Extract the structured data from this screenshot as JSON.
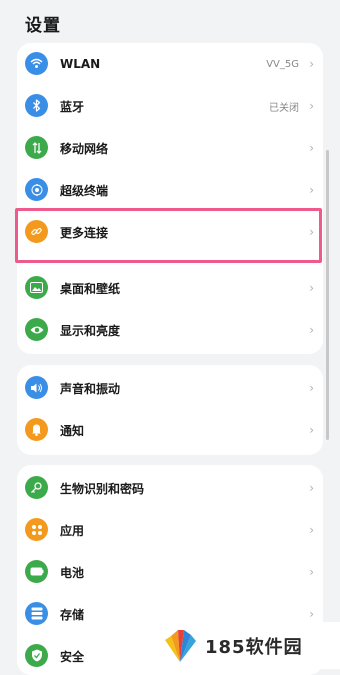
{
  "page_title": "设置",
  "colors": {
    "highlight": "#ee5a8c"
  },
  "group1": [
    {
      "label": "WLAN",
      "value": "VV_5G",
      "icon": "wifi-icon",
      "color": "#3a8ee6"
    },
    {
      "label": "蓝牙",
      "value": "已关闭",
      "icon": "bluetooth-icon",
      "color": "#3a8ee6"
    },
    {
      "label": "移动网络",
      "value": "",
      "icon": "mobile-network-icon",
      "color": "#3caa4a"
    },
    {
      "label": "超级终端",
      "value": "",
      "icon": "super-device-icon",
      "color": "#3a8ee6"
    },
    {
      "label": "更多连接",
      "value": "",
      "icon": "link-icon",
      "color": "#f39a1e"
    },
    {
      "label": "桌面和壁纸",
      "value": "",
      "icon": "wallpaper-icon",
      "color": "#3caa4a"
    },
    {
      "label": "显示和亮度",
      "value": "",
      "icon": "eye-icon",
      "color": "#3caa4a"
    }
  ],
  "group2": [
    {
      "label": "声音和振动",
      "value": "",
      "icon": "speaker-icon",
      "color": "#3a8ee6"
    },
    {
      "label": "通知",
      "value": "",
      "icon": "bell-icon",
      "color": "#f39a1e"
    }
  ],
  "group3": [
    {
      "label": "生物识别和密码",
      "value": "",
      "icon": "key-icon",
      "color": "#3caa4a"
    },
    {
      "label": "应用",
      "value": "",
      "icon": "apps-icon",
      "color": "#f39a1e"
    },
    {
      "label": "电池",
      "value": "",
      "icon": "battery-icon",
      "color": "#3caa4a"
    },
    {
      "label": "存储",
      "value": "",
      "icon": "storage-icon",
      "color": "#3a8ee6"
    },
    {
      "label": "安全",
      "value": "",
      "icon": "shield-icon",
      "color": "#3caa4a"
    }
  ],
  "watermark": {
    "text": "185软件园"
  }
}
